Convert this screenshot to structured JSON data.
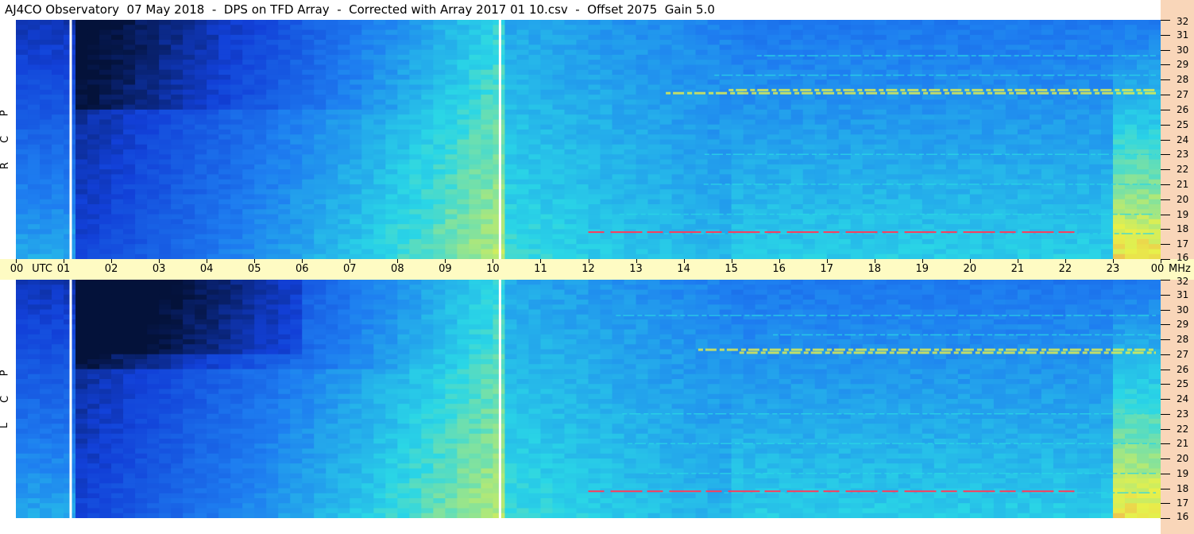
{
  "title": "AJ4CO Observatory  07 May 2018  -  DPS on TFD Array  -  Corrected with Array 2017 01 10.csv  -  Offset 2075  Gain 5.0",
  "chart_data": {
    "type": "heatmap",
    "title": "AJ4CO Observatory  07 May 2018  -  DPS on TFD Array  -  Corrected with Array 2017 01 10.csv  -  Offset 2075  Gain 5.0",
    "x_unit_label": "UTC",
    "y_unit_label": "MHz",
    "xlim": [
      0,
      24
    ],
    "ylim": [
      16,
      32
    ],
    "x_ticks": [
      "00",
      "01",
      "02",
      "03",
      "04",
      "05",
      "06",
      "07",
      "08",
      "09",
      "10",
      "11",
      "12",
      "13",
      "14",
      "15",
      "16",
      "17",
      "18",
      "19",
      "20",
      "21",
      "22",
      "23",
      "00"
    ],
    "y_ticks": [
      "16",
      "17",
      "18",
      "19",
      "20",
      "21",
      "22",
      "23",
      "24",
      "25",
      "26",
      "27",
      "28",
      "29",
      "30",
      "31",
      "32"
    ],
    "panels": [
      {
        "name": "R C P",
        "letters": [
          "R",
          "C",
          "P"
        ]
      },
      {
        "name": "L C P",
        "letters": [
          "L",
          "C",
          "P"
        ]
      }
    ],
    "data_gaps_utc": [
      1.15,
      10.15
    ],
    "colors": {
      "low": "#04123a",
      "mid_low": "#1240d8",
      "mid": "#1e7ef0",
      "mid_high": "#2ad6e6",
      "high": "#e8f04a",
      "peak": "#ff3a5a"
    }
  },
  "axes": {
    "utc_label": "UTC",
    "mhz_label": "MHz"
  }
}
